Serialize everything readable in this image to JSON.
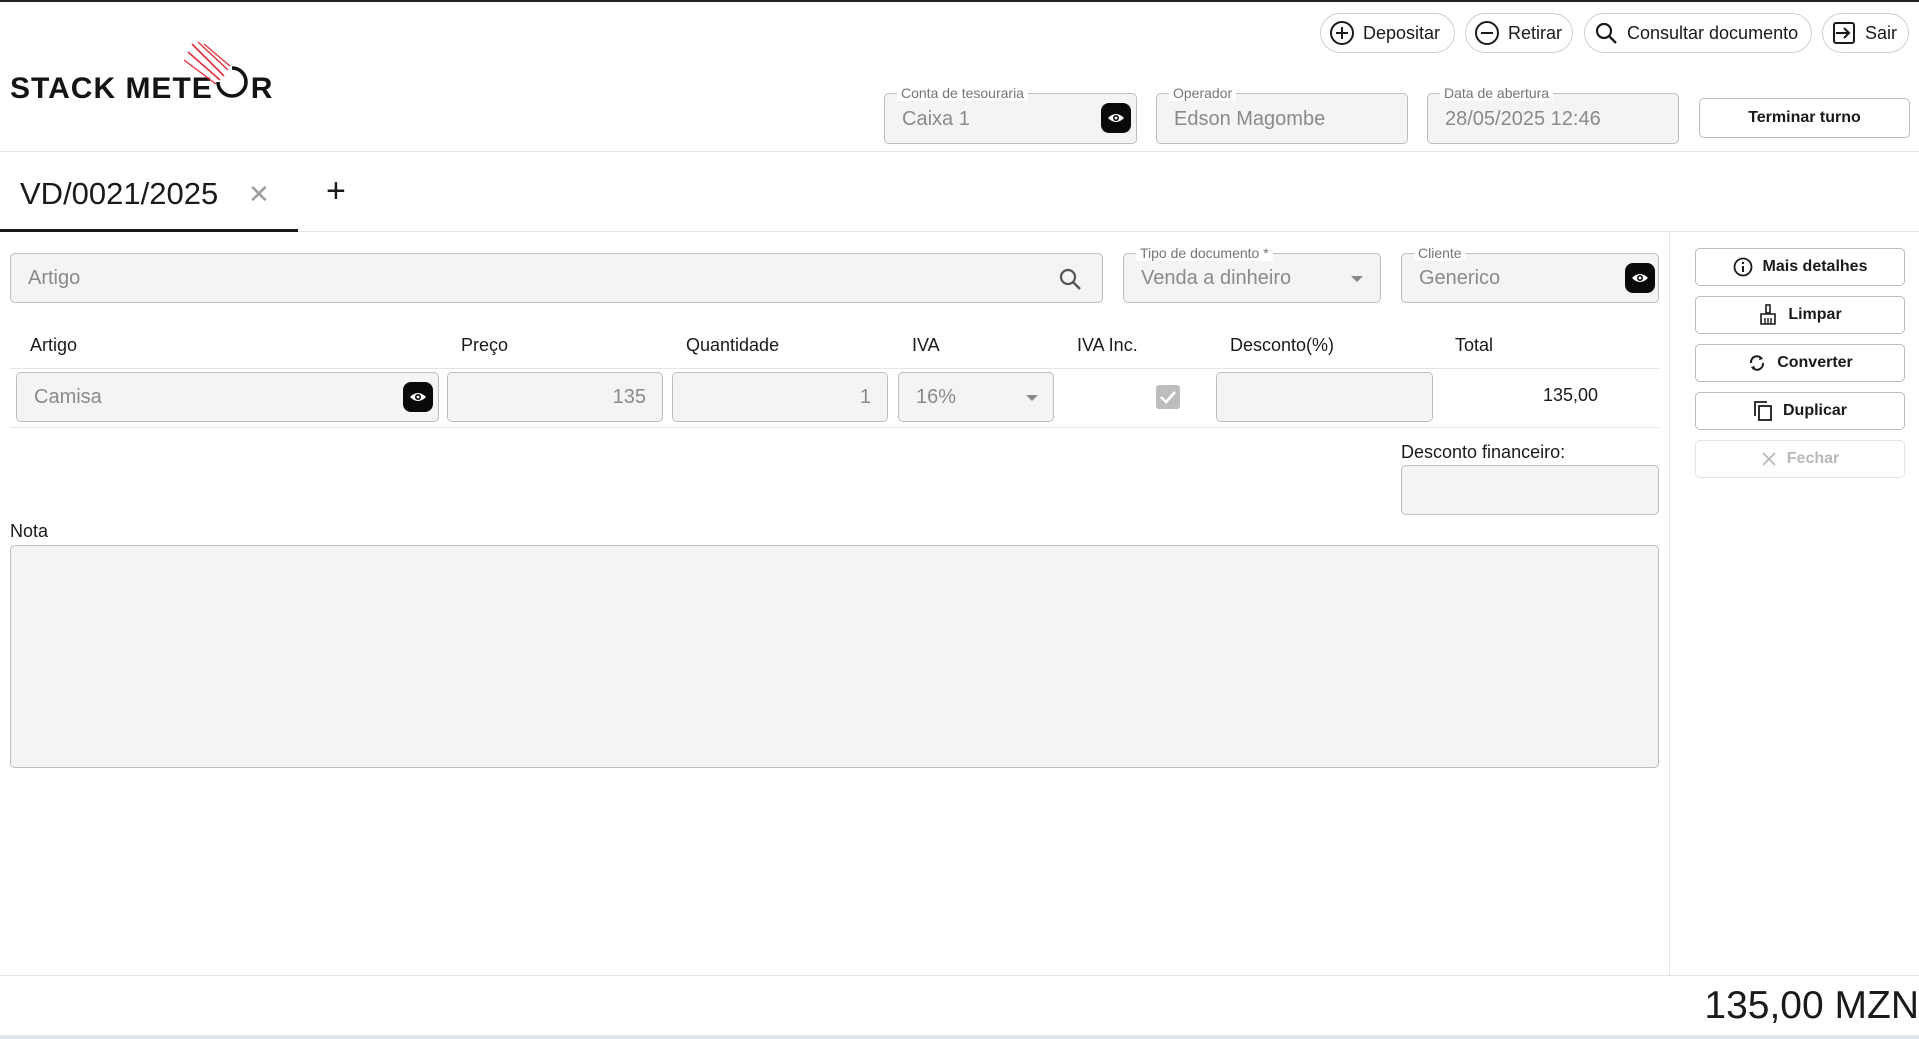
{
  "brand": {
    "name": "STACK METE",
    "name_tail": "R",
    "accent": "#e0303a"
  },
  "toolbar": {
    "deposit_label": "Depositar",
    "withdraw_label": "Retirar",
    "consult_label": "Consultar documento",
    "exit_label": "Sair"
  },
  "session": {
    "treasury": {
      "label": "Conta de tesouraria",
      "value": "Caixa 1"
    },
    "operator": {
      "label": "Operador",
      "value": "Edson Magombe"
    },
    "opened": {
      "label": "Data de abertura",
      "value": "28/05/2025 12:46"
    },
    "end_shift_label": "Terminar turno"
  },
  "tabs": [
    {
      "label": "VD/0021/2025"
    }
  ],
  "form": {
    "article_search_placeholder": "Artigo",
    "doc_type": {
      "label": "Tipo de documento *",
      "value": "Venda a dinheiro"
    },
    "client": {
      "label": "Cliente",
      "value": "Generico"
    }
  },
  "lines": {
    "headers": [
      "Artigo",
      "Preço",
      "Quantidade",
      "IVA",
      "IVA Inc.",
      "Desconto(%)",
      "Total"
    ],
    "rows": [
      {
        "article": "Camisa",
        "price": "135",
        "quantity": "1",
        "vat": "16%",
        "vat_included": true,
        "discount": "",
        "total": "135,00"
      }
    ]
  },
  "financial_discount": {
    "label": "Desconto financeiro:",
    "value": ""
  },
  "note": {
    "label": "Nota",
    "value": ""
  },
  "actions": {
    "details_label": "Mais detalhes",
    "clear_label": "Limpar",
    "convert_label": "Converter",
    "duplicate_label": "Duplicar",
    "close_label": "Fechar"
  },
  "grand_total": "135,00 MZN"
}
